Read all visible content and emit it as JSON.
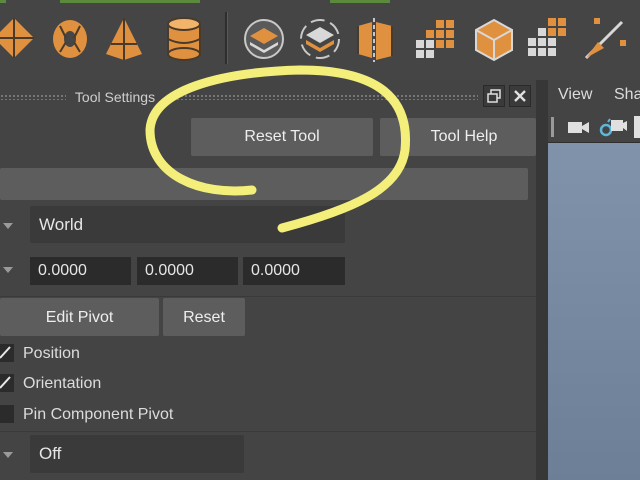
{
  "shelf": {
    "icons": [
      "diamond-face-icon",
      "torus-face-icon",
      "pyramid-face-icon",
      "cylinder-face-icon",
      "extrude-face-icon",
      "bridge-face-icon",
      "split-face-icon",
      "grid-face-icon",
      "cube-component-icon",
      "checker-face-icon",
      "knife-cut-icon"
    ],
    "accent": "#e0913f"
  },
  "tool_settings": {
    "title": "Tool Settings",
    "reset_tool": "Reset Tool",
    "tool_help": "Tool Help",
    "axis_orientation": "World",
    "step_values": [
      "0.0000",
      "0.0000",
      "0.0000"
    ],
    "edit_pivot": "Edit Pivot",
    "reset": "Reset",
    "checkboxes": [
      {
        "label": "Position",
        "checked": true
      },
      {
        "label": "Orientation",
        "checked": true
      },
      {
        "label": "Pin Component Pivot",
        "checked": false
      }
    ],
    "snap_mode": "Off"
  },
  "viewport": {
    "menu": [
      "View",
      "Sha"
    ],
    "background_top": "#8093ab",
    "background_bottom": "#6d7f97"
  },
  "annotation_color": "#f3ef7a"
}
